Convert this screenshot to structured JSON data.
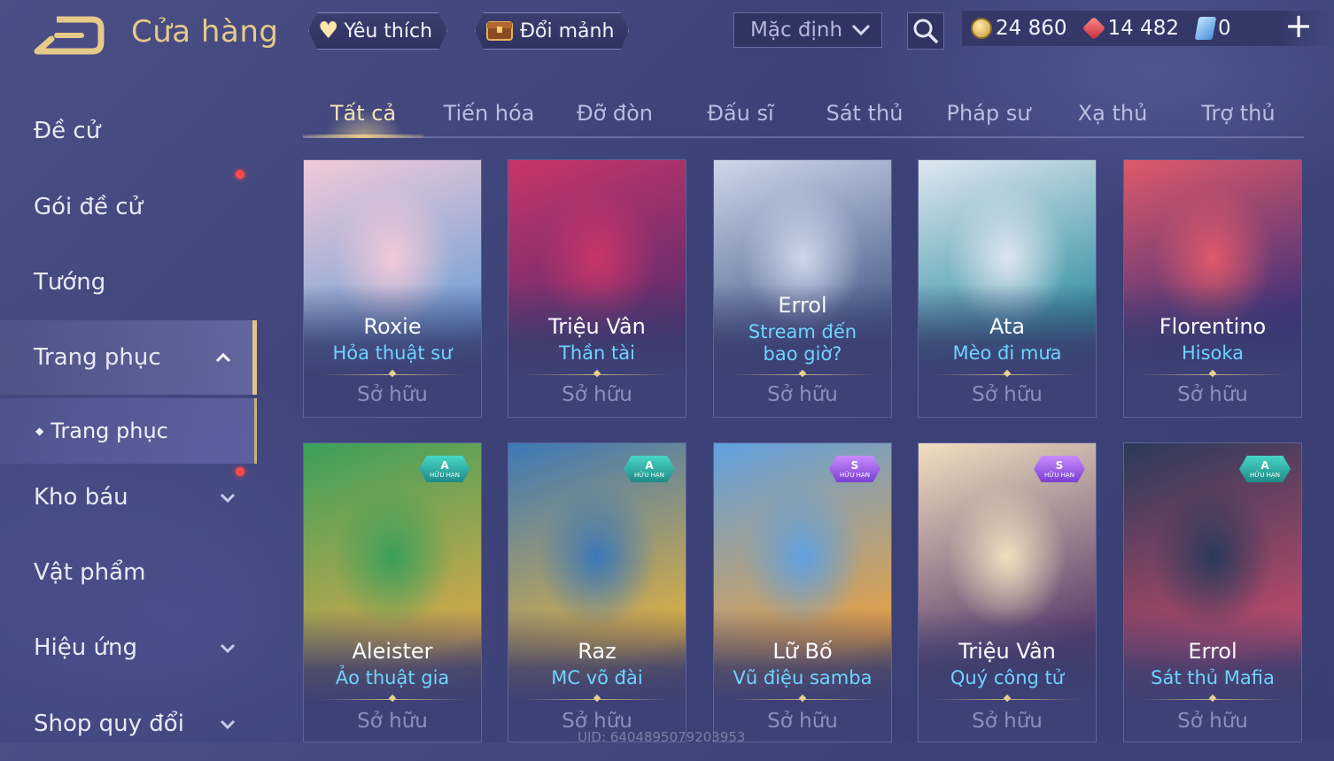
{
  "header": {
    "title": "Cửa hàng",
    "favorites_label": "Yêu thích",
    "exchange_label": "Đổi mảnh",
    "sort_label": "Mặc định"
  },
  "currency": {
    "gold": "24 860",
    "vouchers": "14 482",
    "tickets": "0"
  },
  "sidebar": {
    "items": [
      {
        "label": "Đề cử"
      },
      {
        "label": "Gói đề cử"
      },
      {
        "label": "Tướng"
      },
      {
        "label": "Trang phục"
      },
      {
        "label": "Kho báu"
      },
      {
        "label": "Vật phẩm"
      },
      {
        "label": "Hiệu ứng"
      },
      {
        "label": "Shop quy đổi"
      }
    ],
    "sub_item": "Trang phục"
  },
  "tabs": [
    "Tất cả",
    "Tiến hóa",
    "Đỡ đòn",
    "Đấu sĩ",
    "Sát thủ",
    "Pháp sư",
    "Xạ thủ",
    "Trợ thủ"
  ],
  "cards": [
    {
      "hero": "Roxie",
      "skin": "Hỏa thuật sư",
      "status": "Sở hữu",
      "badge": "",
      "colors": [
        "#f2c9d8",
        "#6fa0d6"
      ]
    },
    {
      "hero": "Triệu Vân",
      "skin": "Thần tài",
      "status": "Sở hữu",
      "badge": "",
      "colors": [
        "#c8356a",
        "#5a2c6e"
      ]
    },
    {
      "hero": "Errol",
      "skin": "Stream đến bao giờ?",
      "status": "Sở hữu",
      "badge": "",
      "colors": [
        "#cdd7ea",
        "#4a5a8a"
      ]
    },
    {
      "hero": "Ata",
      "skin": "Mèo đi mưa",
      "status": "Sở hữu",
      "badge": "",
      "colors": [
        "#dfe6f0",
        "#2f8fa0"
      ]
    },
    {
      "hero": "Florentino",
      "skin": "Hisoka",
      "status": "Sở hữu",
      "badge": "",
      "colors": [
        "#e0596a",
        "#3b2f7a"
      ]
    },
    {
      "hero": "Aleister",
      "skin": "Ảo thuật gia",
      "status": "Sở hữu",
      "badge": "A",
      "badge_text": "HỮU HẠN",
      "colors": [
        "#3aa05a",
        "#d8a84a"
      ]
    },
    {
      "hero": "Raz",
      "skin": "MC võ đài",
      "status": "Sở hữu",
      "badge": "A",
      "badge_text": "HỮU HẠN",
      "colors": [
        "#3c78b8",
        "#e0b040"
      ]
    },
    {
      "hero": "Lữ Bố",
      "skin": "Vũ điệu samba",
      "status": "Sở hữu",
      "badge": "S",
      "badge_text": "HỮU HẠN",
      "colors": [
        "#5fa0e0",
        "#e8a040"
      ]
    },
    {
      "hero": "Triệu Vân",
      "skin": "Quý công tử",
      "status": "Sở hữu",
      "badge": "S",
      "badge_text": "HỮU HẠN",
      "colors": [
        "#f0e0c0",
        "#5a3a6a"
      ]
    },
    {
      "hero": "Errol",
      "skin": "Sát thủ Mafia",
      "status": "Sở hữu",
      "badge": "A",
      "badge_text": "HỮU HẠN",
      "colors": [
        "#2a3a5a",
        "#c04a6a"
      ]
    }
  ],
  "uid_text": "UID: 6404895079203953"
}
